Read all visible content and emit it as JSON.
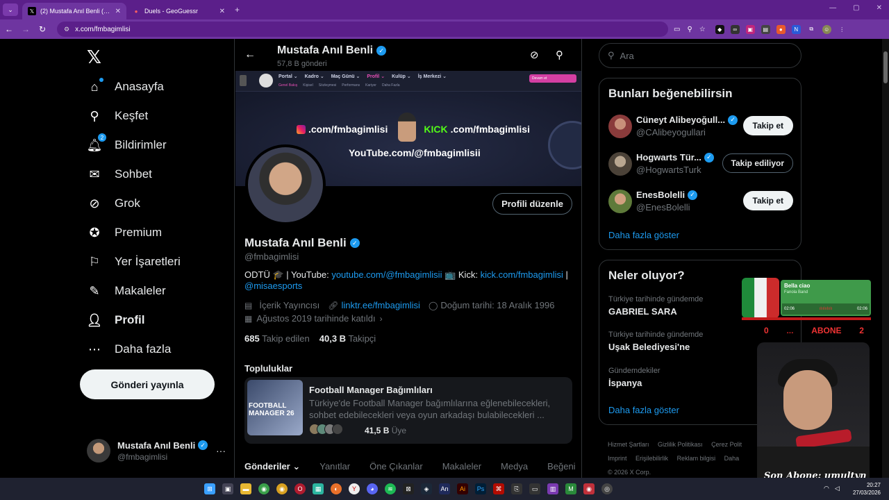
{
  "browser": {
    "tabs": [
      {
        "title": "(2) Mustafa Anıl Benli (@fmbag",
        "active": true
      },
      {
        "title": "Duels - GeoGuessr",
        "active": false
      }
    ],
    "url": "x.com/fmbagimlisi"
  },
  "sidebar": {
    "items": [
      {
        "label": "Anasayfa",
        "icon": "home-icon"
      },
      {
        "label": "Keşfet",
        "icon": "search-icon"
      },
      {
        "label": "Bildirimler",
        "icon": "bell-icon",
        "badge": "2"
      },
      {
        "label": "Sohbet",
        "icon": "mail-icon"
      },
      {
        "label": "Grok",
        "icon": "grok-icon"
      },
      {
        "label": "Premium",
        "icon": "premium-icon"
      },
      {
        "label": "Yer İşaretleri",
        "icon": "bookmark-icon"
      },
      {
        "label": "Makaleler",
        "icon": "article-icon"
      },
      {
        "label": "Profil",
        "icon": "person-icon"
      },
      {
        "label": "Daha fazla",
        "icon": "more-icon"
      }
    ],
    "post_button": "Gönderi yayınla",
    "account": {
      "name": "Mustafa Anıl Benli",
      "handle": "@fmbagimlisi"
    }
  },
  "profile": {
    "header_name": "Mustafa Anıl Benli",
    "post_count": "57,8 B gönderi",
    "banner": {
      "nav": [
        "Portal ⌄",
        "Kadro ⌄",
        "Maç Günü ⌄",
        "Profil ⌄",
        "Kulüp ⌄",
        "İş Merkezi ⌄"
      ],
      "subnav": [
        "Genel Bakış",
        "Kişisel",
        "Sözleşmesi",
        "Performans",
        "Kariyer",
        "Daha Fazla"
      ],
      "continue": "Devam et",
      "line1_a": ".com/fmbagimlisi",
      "line1_b": "KICK",
      "line1_c": ".com/fmbagimlisi",
      "line2": "YouTube.com/@fmbagimlisii"
    },
    "edit_button": "Profili düzenle",
    "name": "Mustafa Anıl Benli",
    "handle": "@fmbagimlisi",
    "bio_prefix": "ODTÜ 🎓 | YouTube: ",
    "bio_youtube": "youtube.com/@fmbagimlisii",
    "bio_mid": " 📺 Kick: ",
    "bio_kick": "kick.com/fmbagimlisi",
    "bio_sep": " |",
    "bio_mention": "@misaesports",
    "category": "İçerik Yayıncısı",
    "website": "linktr.ee/fmbagimlisi",
    "birthday": "Doğum tarihi: 18 Aralık 1996",
    "joined": "Ağustos 2019 tarihinde katıldı",
    "following_count": "685",
    "following_label": "Takip edilen",
    "followers_count": "40,3 B",
    "followers_label": "Takipçi",
    "communities_title": "Topluluklar",
    "community": {
      "name": "Football Manager Bağımlıları",
      "desc": "Türkiye'de Football Manager bağımlılarına eğlenebilecekleri, sohbet edebilecekleri veya oyun arkadaşı bulabilecekleri ...",
      "image_text": "FOOTBALL MANAGER 26",
      "members": "41,5 B",
      "members_label": "Üye"
    },
    "tabs": [
      "Gönderiler ⌄",
      "Yanıtlar",
      "Öne Çıkanlar",
      "Makaleler",
      "Medya",
      "Beğeni"
    ]
  },
  "right": {
    "search_placeholder": "Ara",
    "suggest_title": "Bunları beğenebilirsin",
    "suggestions": [
      {
        "name": "Cüneyt Alibeyoğull...",
        "handle": "@CAlibeyogullari",
        "button": "Takip et"
      },
      {
        "name": "Hogwarts Tür...",
        "handle": "@HogwartsTurk",
        "button": "Takip ediliyor"
      },
      {
        "name": "EnesBolelli",
        "handle": "@EnesBolelli",
        "button": "Takip et"
      }
    ],
    "show_more": "Daha fazla göster",
    "trends_title": "Neler oluyor?",
    "trends": [
      {
        "context": "Türkiye tarihinde gündemde",
        "name": "GABRIEL SARA"
      },
      {
        "context": "Türkiye tarihinde gündemde",
        "name": "Uşak Belediyesi'ne"
      },
      {
        "context": "Gündemdekiler",
        "name": "İspanya"
      }
    ],
    "trends_more": "Daha fazla göster",
    "footer": [
      "Hizmet Şartları",
      "Gizlilik Politikası",
      "Çerez Polit",
      "Imprint",
      "Erişilebilirlik",
      "Reklam bilgisi",
      "Daha",
      "© 2026 X Corp."
    ]
  },
  "overlay": {
    "song": "Bella ciao",
    "artist": "Fanola Band",
    "time_start": "02:06",
    "time_end": "02:06",
    "sub_left": "0",
    "sub_mid": "ABONE",
    "sub_right": "2",
    "sub_dots": "...",
    "caption": "Son Abone: umultyn"
  },
  "taskbar": {
    "time": "20:27",
    "date": "27/03/2026"
  },
  "colors": {
    "accent": "#1d9bf0",
    "browser_frame": "#6e35a0",
    "background": "#000000"
  }
}
